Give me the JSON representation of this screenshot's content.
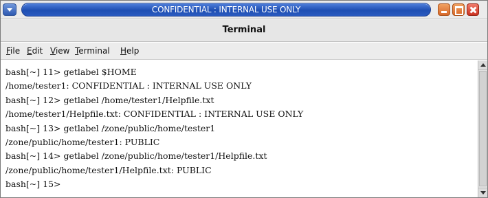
{
  "label_bar": {
    "label": "CONFIDENTIAL : INTERNAL USE ONLY",
    "menu_icon": "window-menu-icon",
    "minimize_icon": "minimize-icon",
    "maximize_icon": "maximize-icon",
    "close_icon": "close-icon"
  },
  "window": {
    "title": "Terminal"
  },
  "menubar": {
    "file": {
      "mnemonic": "F",
      "rest": "ile"
    },
    "edit": {
      "mnemonic": "E",
      "rest": "dit"
    },
    "view": {
      "mnemonic": "V",
      "rest": "iew"
    },
    "terminal": {
      "mnemonic": "T",
      "rest": "erminal"
    },
    "help": {
      "mnemonic": "H",
      "rest": "elp"
    }
  },
  "terminal": {
    "lines": [
      "bash[~] 11> getlabel $HOME",
      "/home/tester1: CONFIDENTIAL : INTERNAL USE ONLY",
      "bash[~] 12> getlabel /home/tester1/Helpfile.txt",
      "/home/tester1/Helpfile.txt: CONFIDENTIAL : INTERNAL USE ONLY",
      "bash[~] 13> getlabel /zone/public/home/tester1",
      "/zone/public/home/tester1: PUBLIC",
      "bash[~] 14> getlabel /zone/public/home/tester1/Helpfile.txt",
      "/zone/public/home/tester1/Helpfile.txt: PUBLIC",
      "bash[~] 15>"
    ]
  },
  "colors": {
    "label_bar_blue": "#1f4fb3",
    "window_button_orange": "#d8692a",
    "window_close_red": "#cc3322"
  }
}
